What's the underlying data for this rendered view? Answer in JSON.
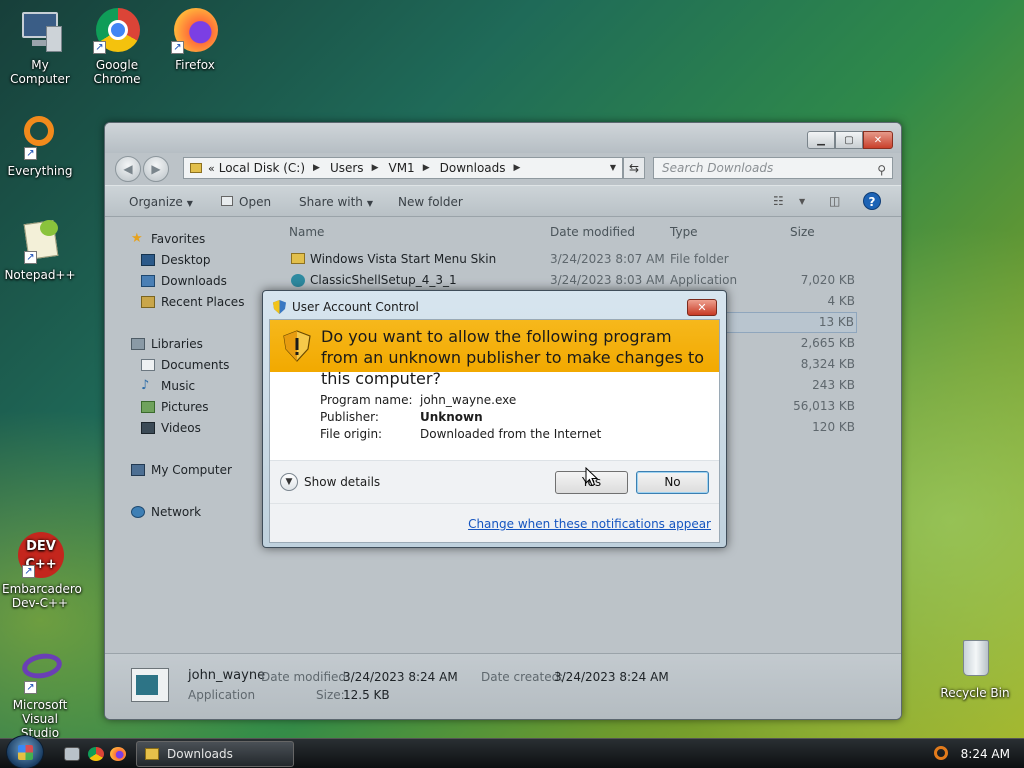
{
  "desktop": {
    "icons": [
      {
        "label": "My Computer"
      },
      {
        "label": "Google Chrome"
      },
      {
        "label": "Firefox"
      },
      {
        "label": "Everything"
      },
      {
        "label": "Notepad++"
      },
      {
        "label": "Embarcadero Dev-C++"
      },
      {
        "label": "Microsoft Visual Studio"
      },
      {
        "label": "Recycle Bin"
      }
    ]
  },
  "explorer": {
    "breadcrumb": [
      "Local Disk (C:)",
      "Users",
      "VM1",
      "Downloads"
    ],
    "search_placeholder": "Search Downloads",
    "toolbar": {
      "organize": "Organize",
      "open": "Open",
      "share_with": "Share with",
      "new_folder": "New folder"
    },
    "nav": {
      "favorites": "Favorites",
      "desktop": "Desktop",
      "downloads": "Downloads",
      "recent_places": "Recent Places",
      "libraries": "Libraries",
      "documents": "Documents",
      "music": "Music",
      "pictures": "Pictures",
      "videos": "Videos",
      "my_computer": "My Computer",
      "network": "Network"
    },
    "columns": {
      "name": "Name",
      "date_modified": "Date modified",
      "type": "Type",
      "size": "Size"
    },
    "files": [
      {
        "name": "Windows Vista Start Menu Skin",
        "date": "3/24/2023 8:07 AM",
        "type": "File folder",
        "size": ""
      },
      {
        "name": "ClassicShellSetup_4_3_1",
        "date": "3/24/2023 8:03 AM",
        "type": "Application",
        "size": "7,020 KB"
      },
      {
        "size": "4 KB"
      },
      {
        "size": "13 KB"
      },
      {
        "size": "2,665 KB"
      },
      {
        "size": "8,324 KB"
      },
      {
        "size": "243 KB"
      },
      {
        "size": "56,013 KB"
      },
      {
        "size": "120 KB"
      }
    ],
    "details": {
      "name": "john_wayne",
      "kind": "Application",
      "date_modified_label": "Date modified:",
      "date_modified": "3/24/2023 8:24 AM",
      "size_label": "Size:",
      "size": "12.5 KB",
      "date_created_label": "Date created:",
      "date_created": "3/24/2023 8:24 AM"
    }
  },
  "uac": {
    "title": "User Account Control",
    "question": "Do you want to allow the following program from an unknown publisher to make changes to this computer?",
    "program_name_label": "Program name:",
    "program_name": "john_wayne.exe",
    "publisher_label": "Publisher:",
    "publisher": "Unknown",
    "file_origin_label": "File origin:",
    "file_origin": "Downloaded from the Internet",
    "show_details": "Show details",
    "yes_button": "Yes",
    "no_button": "No",
    "notifications_link": "Change when these notifications appear",
    "banner_color": "#f4b10a"
  },
  "taskbar": {
    "task_label": "Downloads",
    "clock": "8:24 AM"
  }
}
